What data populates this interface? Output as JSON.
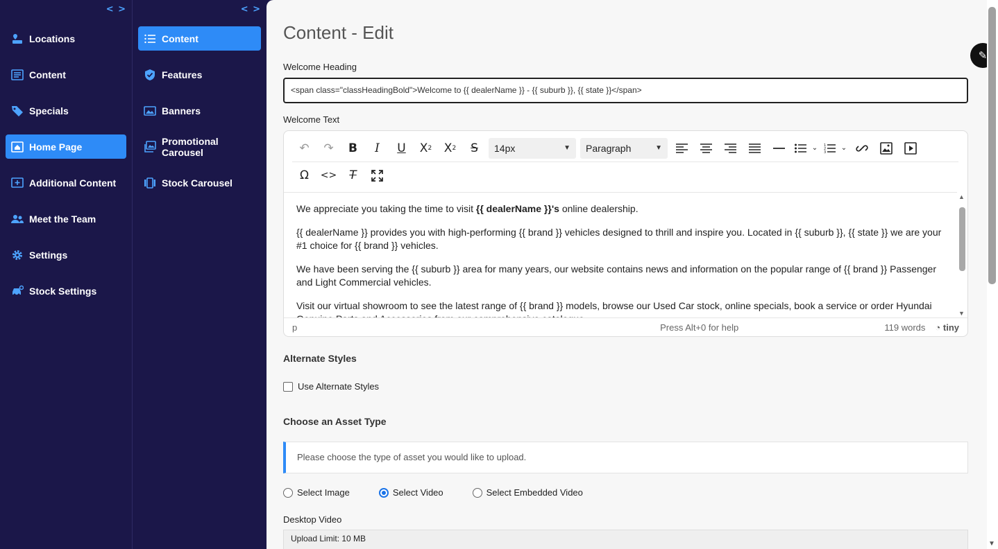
{
  "sidebar_primary": {
    "collapse_label": "< >",
    "items": [
      {
        "label": "Locations",
        "icon": "location-icon",
        "active": false
      },
      {
        "label": "Content",
        "icon": "content-list-icon",
        "active": false
      },
      {
        "label": "Specials",
        "icon": "tag-icon",
        "active": false
      },
      {
        "label": "Home Page",
        "icon": "home-icon",
        "active": true
      },
      {
        "label": "Additional Content",
        "icon": "add-box-icon",
        "active": false
      },
      {
        "label": "Meet the Team",
        "icon": "team-icon",
        "active": false
      },
      {
        "label": "Settings",
        "icon": "gear-icon",
        "active": false
      },
      {
        "label": "Stock Settings",
        "icon": "car-settings-icon",
        "active": false
      }
    ]
  },
  "sidebar_secondary": {
    "collapse_label": "< >",
    "items": [
      {
        "label": "Content",
        "icon": "list-icon",
        "active": true
      },
      {
        "label": "Features",
        "icon": "shield-check-icon",
        "active": false
      },
      {
        "label": "Banners",
        "icon": "image-icon",
        "active": false
      },
      {
        "label": "Promotional Carousel",
        "icon": "images-icon",
        "active": false
      },
      {
        "label": "Stock Carousel",
        "icon": "carousel-icon",
        "active": false
      }
    ]
  },
  "main": {
    "title": "Content - Edit",
    "welcome_heading_label": "Welcome Heading",
    "welcome_heading_value": "<span class=\"classHeadingBold\">Welcome to {{ dealerName }} - {{ suburb }}, {{ state }}</span>",
    "welcome_text_label": "Welcome Text",
    "editor": {
      "font_size": "14px",
      "block_format": "Paragraph",
      "paragraphs": {
        "p1_before": "We appreciate you taking the time to visit ",
        "p1_bold": "{{ dealerName }}'s",
        "p1_after": " online dealership.",
        "p2": "{{ dealerName }} provides you with high-performing {{ brand }} vehicles designed to thrill and inspire you. Located in {{ suburb }}, {{ state }} we are your #1 choice for {{ brand }} vehicles.",
        "p3": "We have been serving the {{ suburb }} area for many years, our website contains news and information on the popular range of {{ brand }} Passenger and Light Commercial vehicles.",
        "p4": "Visit our virtual showroom to see the latest range of {{ brand }} models, browse our Used Car stock, online specials, book a service or order Hyundai Genuine Parts and Accessories from our comprehensive catalogue."
      },
      "status_path": "p",
      "status_help": "Press Alt+0 for help",
      "word_count": "119 words",
      "brand": "tiny"
    },
    "alternate_styles_title": "Alternate Styles",
    "use_alternate_styles_label": "Use Alternate Styles",
    "asset_type_title": "Choose an Asset Type",
    "asset_info": "Please choose the type of asset you would like to upload.",
    "asset_options": [
      {
        "label": "Select Image",
        "selected": false
      },
      {
        "label": "Select Video",
        "selected": true
      },
      {
        "label": "Select Embedded Video",
        "selected": false
      }
    ],
    "desktop_video_label": "Desktop Video",
    "upload_limit": "Upload Limit: 10 MB"
  },
  "colors": {
    "sidebar_bg": "#1b1749",
    "accent": "#2e8bf7",
    "main_bg": "#f7f7f7"
  }
}
